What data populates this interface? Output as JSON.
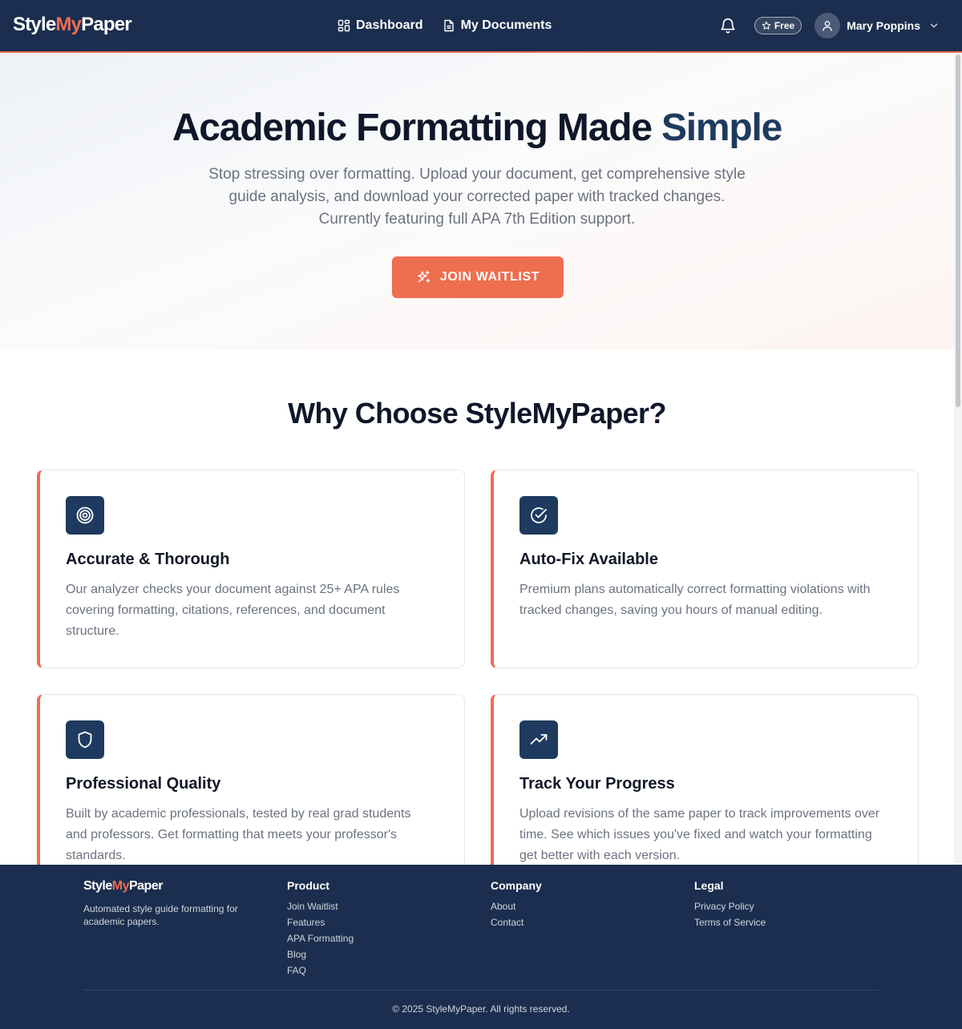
{
  "header": {
    "logo_part1": "Style",
    "logo_part2": "My",
    "logo_part3": "Paper",
    "nav": [
      {
        "label": "Dashboard",
        "icon": "dashboard-grid-icon"
      },
      {
        "label": "My Documents",
        "icon": "document-icon"
      }
    ],
    "notifications_icon": "bell-icon",
    "plan_badge": "Free",
    "plan_icon": "star-icon",
    "user_name": "Mary Poppins",
    "user_icon": "user-icon"
  },
  "hero": {
    "title_main": "Academic Formatting Made",
    "title_highlight": "Simple",
    "subtitle": "Stop stressing over formatting. Upload your document, get comprehensive style guide analysis, and download your corrected paper with tracked changes. Currently featuring full APA 7th Edition support.",
    "cta_label": "JOIN WAITLIST",
    "cta_icon": "sparkles-icon"
  },
  "features": {
    "title": "Why Choose StyleMyPaper?",
    "items": [
      {
        "title": "Accurate & Thorough",
        "text": "Our analyzer checks your document against 25+ APA rules covering formatting, citations, references, and document structure.",
        "icon": "target-icon"
      },
      {
        "title": "Auto-Fix Available",
        "text": "Premium plans automatically correct formatting violations with tracked changes, saving you hours of manual editing.",
        "icon": "check-circle-icon"
      },
      {
        "title": "Professional Quality",
        "text": "Built by academic professionals, tested by real grad students and professors. Get formatting that meets your professor's standards.",
        "icon": "shield-icon"
      },
      {
        "title": "Track Your Progress",
        "text": "Upload revisions of the same paper to track improvements over time. See which issues you've fixed and watch your formatting get better with each version.",
        "icon": "trending-up-icon"
      }
    ]
  },
  "footer": {
    "logo_part1": "Style",
    "logo_part2": "My",
    "logo_part3": "Paper",
    "tagline": "Automated style guide formatting for academic papers.",
    "columns": [
      {
        "heading": "Product",
        "links": [
          "Join Waitlist",
          "Features",
          "APA Formatting",
          "Blog",
          "FAQ"
        ]
      },
      {
        "heading": "Company",
        "links": [
          "About",
          "Contact"
        ]
      },
      {
        "heading": "Legal",
        "links": [
          "Privacy Policy",
          "Terms of Service"
        ]
      }
    ],
    "copyright": "© 2025 StyleMyPaper. All rights reserved."
  },
  "colors": {
    "navy": "#1b2e4f",
    "accent": "#ee6e50",
    "icon_bg": "#1e3a5f"
  }
}
